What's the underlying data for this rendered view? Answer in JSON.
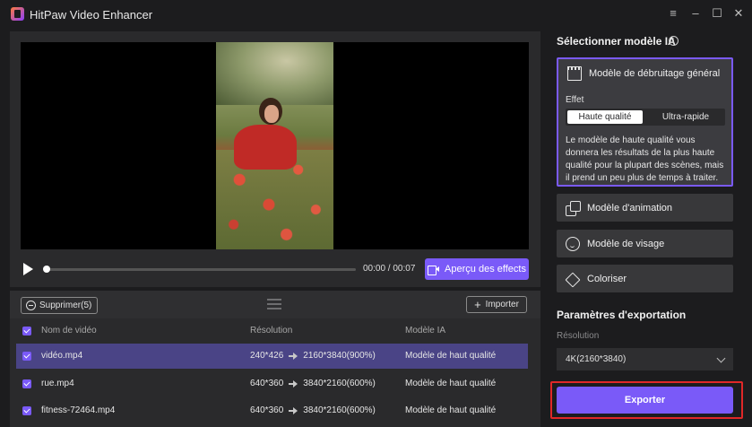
{
  "app": {
    "title": "HitPaw Video Enhancer"
  },
  "window_controls": {
    "menu": "≡",
    "minimize": "–",
    "maximize": "☐",
    "close": "✕"
  },
  "player": {
    "time": "00:00 / 00:07",
    "preview_label": "Aperçu des effects",
    "progress": 0.0
  },
  "list": {
    "delete_label": "Supprimer(5)",
    "import_label": "Importer",
    "headers": {
      "name": "Nom de vidéo",
      "resolution": "Résolution",
      "model": "Modèle IA"
    },
    "rows": [
      {
        "name": "vidéo.mp4",
        "from": "240*426",
        "to": "2160*3840(900%)",
        "model": "Modèle de haut qualité",
        "selected": true
      },
      {
        "name": "rue.mp4",
        "from": "640*360",
        "to": "3840*2160(600%)",
        "model": "Modèle de haut qualité",
        "selected": false
      },
      {
        "name": "fitness-72464.mp4",
        "from": "640*360",
        "to": "3840*2160(600%)",
        "model": "Modèle de haut qualité",
        "selected": false
      }
    ]
  },
  "right": {
    "title": "Sélectionner modèle IA",
    "models": {
      "denoise": "Modèle de débruitage général",
      "animation": "Modèle d'animation",
      "face": "Modèle de visage",
      "colorize": "Coloriser"
    },
    "effect_label": "Effet",
    "effect_options": {
      "high": "Haute qualité",
      "fast": "Ultra-rapide"
    },
    "description": "Le modèle de haute qualité vous donnera les résultats de la plus haute qualité pour la plupart des scènes, mais il prend un peu plus de temps à traiter.",
    "export_title": "Paramètres d'exportation",
    "resolution_label": "Résolution",
    "resolution_value": "4K(2160*3840)",
    "export_button": "Exporter"
  },
  "colors": {
    "accent": "#7a5af8",
    "selected_row": "#4a4486",
    "highlight_border": "#e02828"
  }
}
